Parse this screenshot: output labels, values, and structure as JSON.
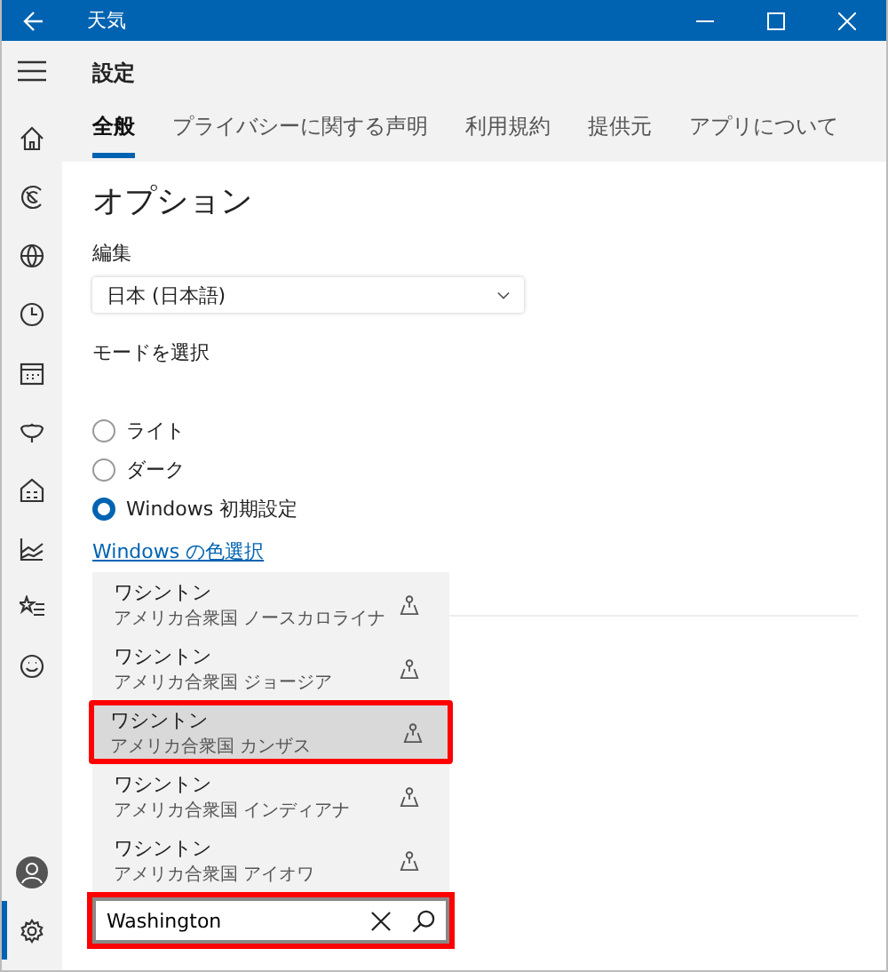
{
  "window": {
    "title": "天気"
  },
  "sidebar": {
    "items": [
      {
        "selected": false
      },
      {
        "selected": false
      },
      {
        "selected": false
      },
      {
        "selected": false
      },
      {
        "selected": false
      },
      {
        "selected": false
      },
      {
        "selected": false
      },
      {
        "selected": false
      },
      {
        "selected": false
      },
      {
        "selected": false
      }
    ],
    "bottom_items": [
      {
        "selected": false
      },
      {
        "selected": true
      }
    ]
  },
  "page_title": "設定",
  "tabs": [
    {
      "label": "全般",
      "selected": true
    },
    {
      "label": "プライバシーに関する声明",
      "selected": false
    },
    {
      "label": "利用規約",
      "selected": false
    },
    {
      "label": "提供元",
      "selected": false
    },
    {
      "label": "アプリについて",
      "selected": false
    }
  ],
  "section_title": "オプション",
  "language": {
    "label": "編集",
    "value": "日本 (日本語)"
  },
  "mode": {
    "label": "モードを選択",
    "options": [
      {
        "label": "ライト",
        "selected": false
      },
      {
        "label": "ダーク",
        "selected": false
      },
      {
        "label": "Windows 初期設定",
        "selected": true
      }
    ],
    "link": "Windows の色選択"
  },
  "suggestions": [
    {
      "name": "ワシントン",
      "region": "アメリカ合衆国 ノースカロライナ",
      "selected": false,
      "highlighted": false
    },
    {
      "name": "ワシントン",
      "region": "アメリカ合衆国 ジョージア",
      "selected": false,
      "highlighted": false
    },
    {
      "name": "ワシントン",
      "region": "アメリカ合衆国 カンザス",
      "selected": true,
      "highlighted": true
    },
    {
      "name": "ワシントン",
      "region": "アメリカ合衆国 インディアナ",
      "selected": false,
      "highlighted": false
    },
    {
      "name": "ワシントン",
      "region": "アメリカ合衆国 アイオワ",
      "selected": false,
      "highlighted": false
    }
  ],
  "search": {
    "value": "Washington",
    "highlighted": true
  }
}
